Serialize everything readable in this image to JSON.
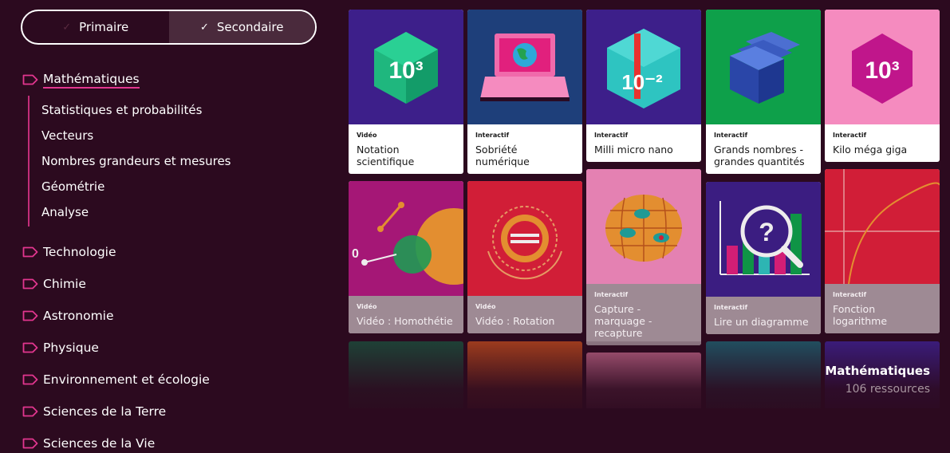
{
  "level_toggle": {
    "primary_label": "Primaire",
    "secondary_label": "Secondaire"
  },
  "categories": [
    {
      "label": "Mathématiques",
      "active": true
    },
    {
      "label": "Technologie"
    },
    {
      "label": "Chimie"
    },
    {
      "label": "Astronomie"
    },
    {
      "label": "Physique"
    },
    {
      "label": "Environnement et écologie"
    },
    {
      "label": "Sciences de la Terre"
    },
    {
      "label": "Sciences de la Vie"
    }
  ],
  "subcategories": [
    "Statistiques et probabilités",
    "Vecteurs",
    "Nombres grandeurs et mesures",
    "Géométrie",
    "Analyse"
  ],
  "cards": [
    {
      "type": "Vidéo",
      "title": "Notation scientifique",
      "thumb_color": "#3d1f8a"
    },
    {
      "type": "Interactif",
      "title": "Sobriété numérique",
      "thumb_color": "#1e3f7a"
    },
    {
      "type": "Interactif",
      "title": "Milli micro nano",
      "thumb_color": "#3d1f8a"
    },
    {
      "type": "Interactif",
      "title": "Grands nombres - grandes quantités",
      "thumb_color": "#0ea04a"
    },
    {
      "type": "Interactif",
      "title": "Kilo méga giga",
      "thumb_color": "#f58bbf"
    },
    {
      "type": "Vidéo",
      "title": "Vidéo : Homothétie",
      "thumb_color": "#b0187e"
    },
    {
      "type": "Vidéo",
      "title": "Vidéo : Rotation",
      "thumb_color": "#e0203a"
    },
    {
      "type": "Interactif",
      "title": "Capture - marquage - recapture",
      "thumb_color": "#f58bbf"
    },
    {
      "type": "Interactif",
      "title": "Lire un diagramme",
      "thumb_color": "#3d1f8a"
    },
    {
      "type": "Interactif",
      "title": "Fonction logarithme",
      "thumb_color": "#e0203a"
    }
  ],
  "thumb_texts": {
    "notation": "10³",
    "milli": "10⁻²",
    "kilo": "10³",
    "homothetie_zero": "0",
    "diagramme": "?"
  },
  "summary": {
    "title": "Mathématiques",
    "count": "106 ressources"
  },
  "colors": {
    "background": "#2c0a1f",
    "accent": "#e2368f"
  }
}
